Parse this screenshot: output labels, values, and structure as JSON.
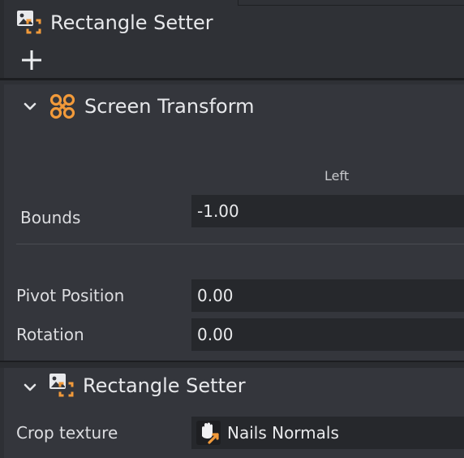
{
  "top": {
    "title": "Rectangle Setter",
    "icon": "rectangle-setter-icon",
    "add_icon": "plus-icon"
  },
  "screen_transform": {
    "title": "Screen Transform",
    "icon": "screen-transform-icon",
    "bounds": {
      "column_header": "Left",
      "label": "Bounds",
      "value": "-1.00"
    },
    "pivot_position": {
      "label": "Pivot Position",
      "value": "0.00"
    },
    "rotation": {
      "label": "Rotation",
      "value": "0.00"
    }
  },
  "rectangle_setter": {
    "title": "Rectangle Setter",
    "icon": "rectangle-setter-icon",
    "crop_texture": {
      "label": "Crop texture",
      "value": "Nails Normals",
      "icon": "texture-hand-icon"
    }
  },
  "colors": {
    "accent_orange": "#f29a3a",
    "panel_bg": "#34363c",
    "field_bg": "#26282c"
  }
}
